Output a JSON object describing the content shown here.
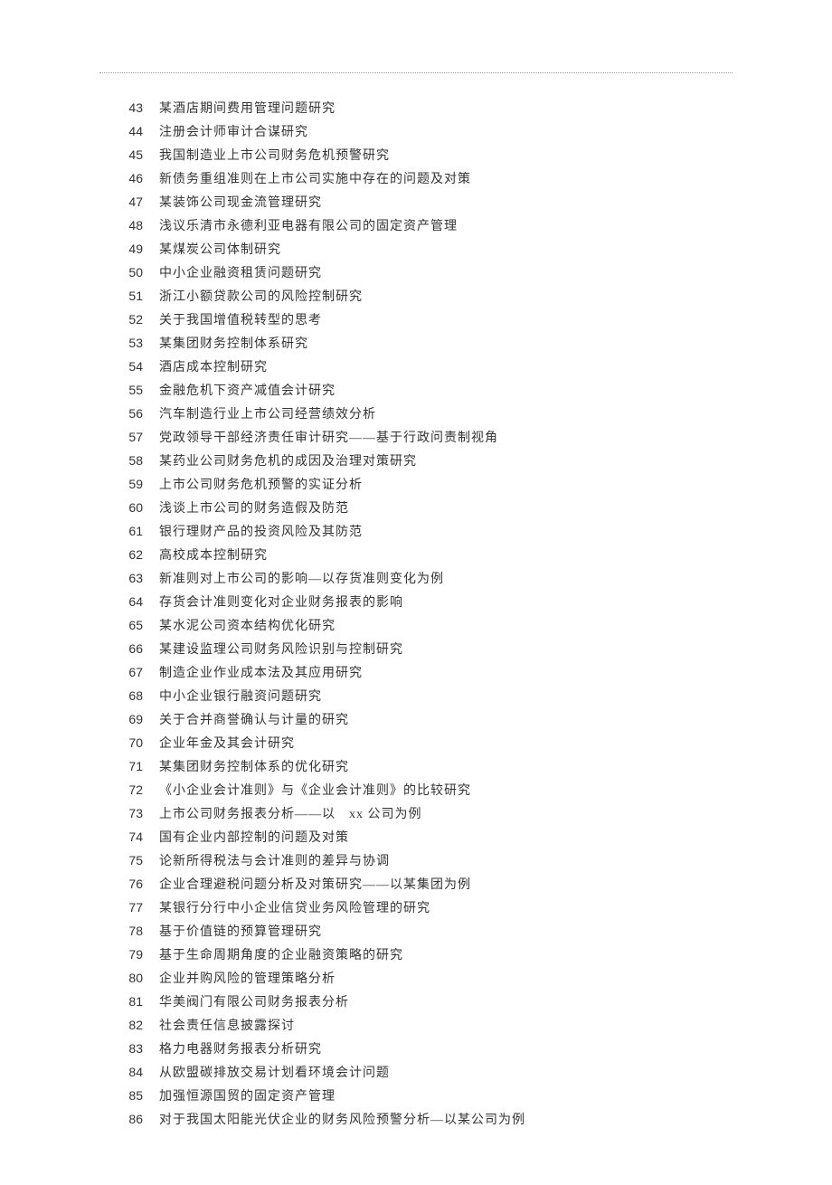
{
  "items": [
    {
      "num": "43",
      "title": "某酒店期间费用管理问题研究"
    },
    {
      "num": "44",
      "title": "注册会计师审计合谋研究"
    },
    {
      "num": "45",
      "title": "我国制造业上市公司财务危机预警研究"
    },
    {
      "num": "46",
      "title": "新债务重组准则在上市公司实施中存在的问题及对策"
    },
    {
      "num": "47",
      "title": "某装饰公司现金流管理研究"
    },
    {
      "num": "48",
      "title": "浅议乐清市永德利亚电器有限公司的固定资产管理"
    },
    {
      "num": "49",
      "title": "某煤炭公司体制研究"
    },
    {
      "num": "50",
      "title": "中小企业融资租赁问题研究"
    },
    {
      "num": "51",
      "title": "浙江小额贷款公司的风险控制研究"
    },
    {
      "num": "52",
      "title": "关于我国增值税转型的思考"
    },
    {
      "num": "53",
      "title": "某集团财务控制体系研究"
    },
    {
      "num": "54",
      "title": "酒店成本控制研究"
    },
    {
      "num": "55",
      "title": "金融危机下资产减值会计研究"
    },
    {
      "num": "56",
      "title": "汽车制造行业上市公司经营绩效分析"
    },
    {
      "num": "57",
      "title": "党政领导干部经济责任审计研究——基于行政问责制视角"
    },
    {
      "num": "58",
      "title": "某药业公司财务危机的成因及治理对策研究"
    },
    {
      "num": "59",
      "title": "上市公司财务危机预警的实证分析"
    },
    {
      "num": "60",
      "title": "浅谈上市公司的财务造假及防范"
    },
    {
      "num": "61",
      "title": "银行理财产品的投资风险及其防范"
    },
    {
      "num": "62",
      "title": "高校成本控制研究"
    },
    {
      "num": "63",
      "title": "新准则对上市公司的影响—以存货准则变化为例"
    },
    {
      "num": "64",
      "title": "存货会计准则变化对企业财务报表的影响"
    },
    {
      "num": "65",
      "title": "某水泥公司资本结构优化研究"
    },
    {
      "num": "66",
      "title": "某建设监理公司财务风险识别与控制研究"
    },
    {
      "num": "67",
      "title": "制造企业作业成本法及其应用研究"
    },
    {
      "num": "68",
      "title": "中小企业银行融资问题研究"
    },
    {
      "num": "69",
      "title": "关于合并商誉确认与计量的研究"
    },
    {
      "num": "70",
      "title": "企业年金及其会计研究"
    },
    {
      "num": "71",
      "title": "某集团财务控制体系的优化研究"
    },
    {
      "num": "72",
      "title": "《小企业会计准则》与《企业会计准则》的比较研究"
    },
    {
      "num": "73",
      "title": "上市公司财务报表分析――以　xx 公司为例"
    },
    {
      "num": "74",
      "title": "国有企业内部控制的问题及对策"
    },
    {
      "num": "75",
      "title": "论新所得税法与会计准则的差异与协调"
    },
    {
      "num": "76",
      "title": "企业合理避税问题分析及对策研究——以某集团为例"
    },
    {
      "num": "77",
      "title": "某银行分行中小企业信贷业务风险管理的研究"
    },
    {
      "num": "78",
      "title": "基于价值链的预算管理研究"
    },
    {
      "num": "79",
      "title": "基于生命周期角度的企业融资策略的研究"
    },
    {
      "num": "80",
      "title": "企业并购风险的管理策略分析"
    },
    {
      "num": "81",
      "title": "华美阀门有限公司财务报表分析"
    },
    {
      "num": "82",
      "title": "社会责任信息披露探讨"
    },
    {
      "num": "83",
      "title": "格力电器财务报表分析研究"
    },
    {
      "num": "84",
      "title": "从欧盟碳排放交易计划看环境会计问题"
    },
    {
      "num": "85",
      "title": "加强恒源国贸的固定资产管理"
    },
    {
      "num": "86",
      "title": "对于我国太阳能光伏企业的财务风险预警分析—以某公司为例"
    }
  ]
}
